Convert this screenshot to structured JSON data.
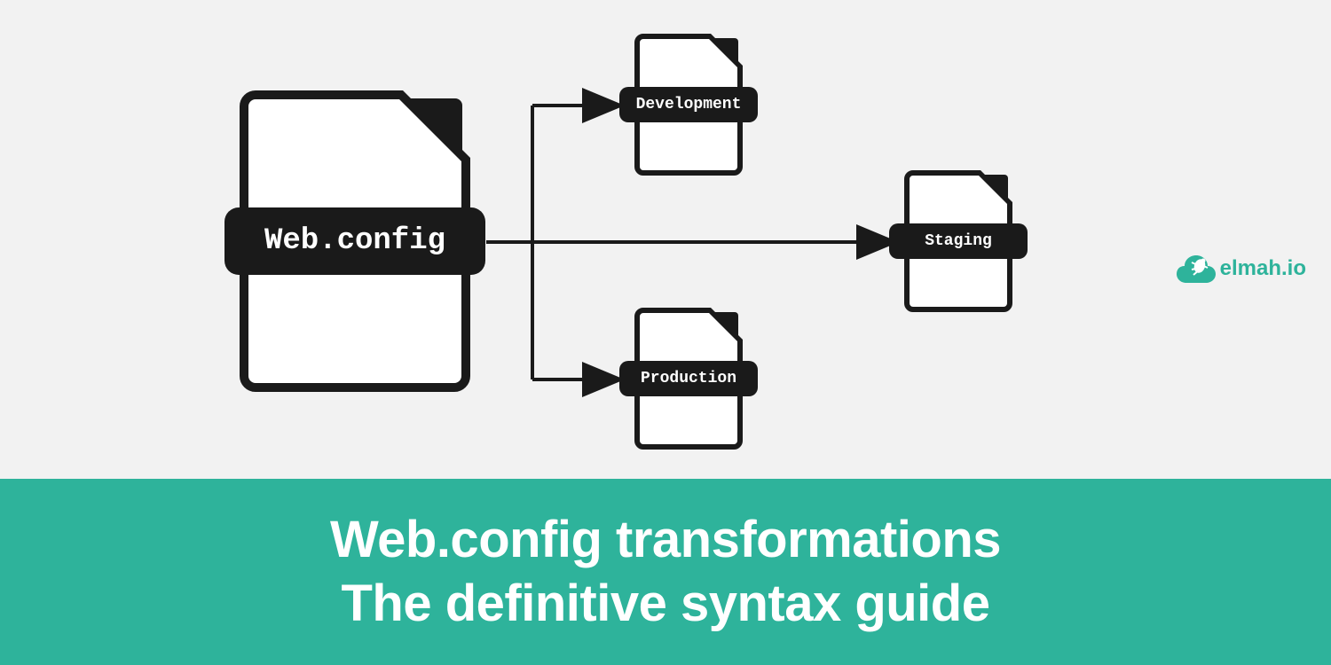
{
  "source_file": {
    "label": "Web.config"
  },
  "targets": [
    {
      "label": "Development"
    },
    {
      "label": "Staging"
    },
    {
      "label": "Production"
    }
  ],
  "brand": {
    "name": "elmah.io"
  },
  "banner": {
    "line1": "Web.config transformations",
    "line2": "The definitive syntax guide"
  },
  "colors": {
    "bg": "#f2f2f2",
    "accent": "#2eb39b",
    "ink": "#1a1a1a"
  }
}
